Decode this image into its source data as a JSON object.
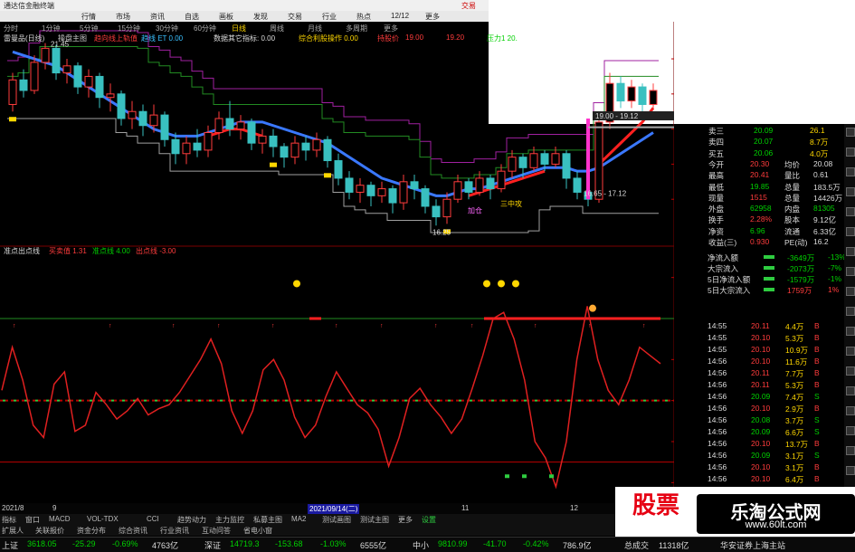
{
  "app": {
    "title": "通达信金融终端",
    "window_right": "交易",
    "menus": [
      "行情",
      "市场",
      "资讯",
      "自选",
      "画板",
      "发现",
      "交易",
      "行业",
      "热点",
      "12/12",
      "更多"
    ],
    "periods": [
      "分时",
      "1分钟",
      "5分钟",
      "15分钟",
      "30分钟",
      "60分钟",
      "日线",
      "周线",
      "月线",
      "多周期",
      "更多"
    ]
  },
  "main_chart": {
    "title": "雷曼品(日线)",
    "sub": "操盘主图",
    "indicators": [
      {
        "label": "趋向线上轨值",
        "color": "#ff3c3c"
      },
      {
        "label": "趋线 ET 0.00",
        "color": "#39c0ff"
      },
      {
        "label": "数据其它指标: 0.00",
        "color": "#dddddd"
      },
      {
        "label": "综合利股操作 0.00",
        "color": "#ffd700"
      },
      {
        "label": "持股价",
        "color": "#ff3c3c"
      },
      {
        "label": "19.00",
        "color": "#ff3c3c"
      },
      {
        "label": "19.20",
        "color": "#ff3c3c"
      },
      {
        "label": "压力1 20.",
        "color": "#00d000"
      }
    ],
    "high_label": "21.45",
    "low_label": "16.25",
    "annotations": [
      "19.00 - 19.12",
      "16.65 - 17.12"
    ],
    "markers": [
      "三中攻",
      "加仓"
    ],
    "price_axis": [
      "21.00",
      "20.00",
      "19.00",
      "18.00",
      "17.00"
    ],
    "candles": [
      {
        "o": 19.7,
        "c": 20.4,
        "h": 20.6,
        "l": 19.5
      },
      {
        "o": 20.4,
        "c": 20.1,
        "h": 20.7,
        "l": 19.9
      },
      {
        "o": 20.1,
        "c": 20.9,
        "h": 21.1,
        "l": 20.0
      },
      {
        "o": 20.9,
        "c": 21.3,
        "h": 21.45,
        "l": 20.7
      },
      {
        "o": 21.3,
        "c": 20.6,
        "h": 21.4,
        "l": 20.4
      },
      {
        "o": 20.6,
        "c": 20.8,
        "h": 21.0,
        "l": 20.3
      },
      {
        "o": 20.8,
        "c": 20.2,
        "h": 20.9,
        "l": 20.0
      },
      {
        "o": 20.2,
        "c": 20.5,
        "h": 20.7,
        "l": 19.9
      },
      {
        "o": 20.5,
        "c": 19.9,
        "h": 20.6,
        "l": 19.6
      },
      {
        "o": 19.9,
        "c": 20.0,
        "h": 20.3,
        "l": 19.5
      },
      {
        "o": 20.0,
        "c": 19.3,
        "h": 20.1,
        "l": 19.1
      },
      {
        "o": 19.3,
        "c": 19.5,
        "h": 19.8,
        "l": 19.0
      },
      {
        "o": 19.5,
        "c": 19.1,
        "h": 19.7,
        "l": 18.8
      },
      {
        "o": 19.1,
        "c": 19.4,
        "h": 19.7,
        "l": 18.9
      },
      {
        "o": 19.4,
        "c": 18.7,
        "h": 19.5,
        "l": 18.5
      },
      {
        "o": 18.7,
        "c": 18.3,
        "h": 18.9,
        "l": 18.0
      },
      {
        "o": 18.3,
        "c": 18.6,
        "h": 18.8,
        "l": 18.0
      },
      {
        "o": 18.6,
        "c": 18.4,
        "h": 19.0,
        "l": 18.2
      },
      {
        "o": 18.4,
        "c": 18.9,
        "h": 19.1,
        "l": 18.2
      },
      {
        "o": 18.9,
        "c": 19.3,
        "h": 19.5,
        "l": 18.7
      },
      {
        "o": 19.3,
        "c": 19.0,
        "h": 19.8,
        "l": 18.8
      },
      {
        "o": 19.0,
        "c": 19.2,
        "h": 19.4,
        "l": 18.7
      },
      {
        "o": 19.2,
        "c": 18.6,
        "h": 19.3,
        "l": 18.4
      },
      {
        "o": 18.6,
        "c": 18.8,
        "h": 19.0,
        "l": 18.3
      },
      {
        "o": 18.8,
        "c": 18.5,
        "h": 19.0,
        "l": 18.2
      },
      {
        "o": 18.5,
        "c": 18.2,
        "h": 18.6,
        "l": 17.9
      },
      {
        "o": 18.2,
        "c": 18.6,
        "h": 18.8,
        "l": 18.0
      },
      {
        "o": 18.6,
        "c": 18.4,
        "h": 18.8,
        "l": 18.1
      },
      {
        "o": 18.4,
        "c": 18.7,
        "h": 18.9,
        "l": 18.2
      },
      {
        "o": 18.7,
        "c": 18.1,
        "h": 18.8,
        "l": 17.9
      },
      {
        "o": 18.1,
        "c": 17.6,
        "h": 18.3,
        "l": 17.4
      },
      {
        "o": 17.6,
        "c": 17.2,
        "h": 17.8,
        "l": 17.0
      },
      {
        "o": 17.2,
        "c": 17.4,
        "h": 17.6,
        "l": 16.9
      },
      {
        "o": 17.4,
        "c": 17.1,
        "h": 17.5,
        "l": 16.8
      },
      {
        "o": 17.1,
        "c": 17.3,
        "h": 17.5,
        "l": 16.9
      },
      {
        "o": 17.3,
        "c": 16.9,
        "h": 17.4,
        "l": 16.6
      },
      {
        "o": 16.9,
        "c": 17.5,
        "h": 17.7,
        "l": 16.7
      },
      {
        "o": 17.5,
        "c": 17.3,
        "h": 17.7,
        "l": 17.0
      },
      {
        "o": 17.3,
        "c": 16.8,
        "h": 17.4,
        "l": 16.6
      },
      {
        "o": 16.8,
        "c": 16.5,
        "h": 17.0,
        "l": 16.25
      },
      {
        "o": 16.5,
        "c": 17.0,
        "h": 17.2,
        "l": 16.3
      },
      {
        "o": 17.0,
        "c": 17.5,
        "h": 17.7,
        "l": 16.9
      },
      {
        "o": 17.5,
        "c": 17.2,
        "h": 17.6,
        "l": 17.0
      },
      {
        "o": 17.2,
        "c": 17.6,
        "h": 17.8,
        "l": 17.1
      },
      {
        "o": 17.6,
        "c": 17.3,
        "h": 17.7,
        "l": 17.0
      },
      {
        "o": 17.3,
        "c": 17.8,
        "h": 18.0,
        "l": 17.2
      },
      {
        "o": 17.8,
        "c": 18.2,
        "h": 18.4,
        "l": 17.6
      },
      {
        "o": 18.2,
        "c": 17.9,
        "h": 18.3,
        "l": 17.6
      },
      {
        "o": 17.9,
        "c": 18.3,
        "h": 18.5,
        "l": 17.8
      },
      {
        "o": 18.3,
        "c": 18.0,
        "h": 18.4,
        "l": 17.8
      },
      {
        "o": 18.0,
        "c": 18.3,
        "h": 18.5,
        "l": 17.9
      },
      {
        "o": 18.3,
        "c": 17.6,
        "h": 18.4,
        "l": 17.3
      },
      {
        "o": 17.6,
        "c": 17.2,
        "h": 17.8,
        "l": 17.0
      },
      {
        "o": 17.2,
        "c": 17.0,
        "h": 17.4,
        "l": 16.8
      },
      {
        "o": 17.0,
        "c": 19.2,
        "h": 19.4,
        "l": 16.9
      },
      {
        "o": 19.2,
        "c": 20.3,
        "h": 20.6,
        "l": 19.0
      },
      {
        "o": 20.3,
        "c": 19.8,
        "h": 20.5,
        "l": 19.6
      },
      {
        "o": 19.8,
        "c": 20.2,
        "h": 20.4,
        "l": 19.6
      },
      {
        "o": 20.2,
        "c": 19.7,
        "h": 20.3,
        "l": 19.5
      },
      {
        "o": 19.7,
        "c": 20.1,
        "h": 20.3,
        "l": 19.6
      }
    ],
    "ma_blue": [
      21.2,
      21.1,
      21.0,
      20.9,
      20.8,
      20.6,
      20.4,
      20.2,
      20.0,
      19.8,
      19.6,
      19.4,
      19.2,
      19.0,
      18.9,
      18.8,
      18.8,
      18.8,
      18.9,
      19.0,
      19.1,
      19.2,
      19.2,
      19.2,
      19.1,
      19.0,
      18.9,
      18.8,
      18.7,
      18.6,
      18.4,
      18.2,
      18.0,
      17.8,
      17.6,
      17.5,
      17.4,
      17.3,
      17.2,
      17.1,
      17.1,
      17.2,
      17.3,
      17.3,
      17.4,
      17.5,
      17.6,
      17.7,
      17.8,
      17.9,
      17.9,
      17.9,
      17.8,
      17.8,
      17.9,
      18.1,
      18.3,
      18.5,
      18.7,
      18.9
    ],
    "ma_red": [
      null,
      null,
      null,
      null,
      null,
      null,
      null,
      null,
      null,
      null,
      null,
      null,
      null,
      null,
      null,
      null,
      null,
      null,
      18.8,
      18.9,
      19.0,
      19.0,
      18.9,
      18.8,
      null,
      null,
      null,
      null,
      null,
      null,
      null,
      null,
      null,
      null,
      null,
      null,
      null,
      null,
      null,
      null,
      null,
      null,
      17.1,
      17.2,
      17.3,
      17.4,
      17.5,
      17.6,
      17.7,
      17.8,
      null,
      null,
      null,
      null,
      18.0,
      18.3,
      18.6,
      18.9,
      19.2,
      19.6
    ]
  },
  "sub_chart": {
    "title": "准点出点线",
    "labels": [
      {
        "text": "买卖值 1.31",
        "color": "#ff3c3c"
      },
      {
        "text": "准点线 4.00",
        "color": "#00d000"
      },
      {
        "text": "出点线 -3.00",
        "color": "#ff3c3c"
      }
    ],
    "axis": [
      "6.00",
      "4.00",
      "2.00",
      "0.00",
      "-2.00",
      "-4.00"
    ],
    "current_tag": "2.70",
    "line": [
      0.5,
      2.6,
      1.0,
      -1.2,
      -1.8,
      0.8,
      1.4,
      -1.5,
      -1.2,
      0.4,
      -0.2,
      -0.9,
      -0.5,
      0.1,
      -0.7,
      -0.4,
      -0.2,
      0.4,
      1.2,
      2.0,
      3.0,
      1.8,
      -0.5,
      -1.6,
      -0.5,
      1.5,
      2.0,
      1.0,
      -0.8,
      -1.8,
      -1.2,
      0.2,
      1.4,
      0.6,
      -0.2,
      -0.6,
      -1.4,
      -3.2,
      -1.8,
      0.1,
      0.6,
      -0.2,
      -0.8,
      -1.6,
      -0.9,
      0.6,
      2.2,
      4.0,
      4.3,
      3.0,
      1.0,
      -2.0,
      -2.8,
      -4.2,
      -2.0,
      2.0,
      4.6,
      2.0,
      0.5,
      -0.2,
      1.0,
      2.6,
      2.2,
      1.8
    ]
  },
  "quote": {
    "rows": [
      {
        "k": "卖三",
        "v": "20.09",
        "v2": "26.1",
        "c": "green"
      },
      {
        "k": "卖四",
        "v": "20.07",
        "v2": "8.7万",
        "c": "green"
      },
      {
        "k": "买五",
        "v": "20.06",
        "v2": "4.0万",
        "c": "green"
      },
      {
        "k": "今开",
        "v": "20.30",
        "k2": "均价",
        "v3": "20.08"
      },
      {
        "k": "最高",
        "v": "20.41",
        "k2": "量比",
        "v3": "0.61"
      },
      {
        "k": "最低",
        "v": "19.85",
        "k2": "总量",
        "v3": "183.5万"
      },
      {
        "k": "现量",
        "v": "1515",
        "k2": "总量",
        "v3": "14426万"
      },
      {
        "k": "外盘",
        "v": "62958",
        "k2": "内盘",
        "v3": "81305"
      },
      {
        "k": "换手",
        "v": "2.28%",
        "k2": "股本",
        "v3": "9.12亿"
      },
      {
        "k": "净资",
        "v": "6.96",
        "k2": "流通",
        "v3": "6.33亿"
      },
      {
        "k": "收益(三)",
        "v": "0.930",
        "k2": "PE(动)",
        "v3": "16.2"
      }
    ]
  },
  "flow": [
    {
      "k": "净流入额",
      "v": "-3649万",
      "p": "-13%"
    },
    {
      "k": "大宗流入",
      "v": "-2073万",
      "p": "-7%"
    },
    {
      "k": "5日净流入额",
      "v": "-1579万",
      "p": "-1%"
    },
    {
      "k": "5日大宗流入",
      "v": "1759万",
      "p": "1%"
    }
  ],
  "ticks": [
    {
      "t": "14:55",
      "p": "20.11",
      "v": "4.4万",
      "s": "B"
    },
    {
      "t": "14:55",
      "p": "20.10",
      "v": "5.3万",
      "s": "B"
    },
    {
      "t": "14:55",
      "p": "20.10",
      "v": "10.9万",
      "s": "B"
    },
    {
      "t": "14:56",
      "p": "20.10",
      "v": "11.6万",
      "s": "B"
    },
    {
      "t": "14:56",
      "p": "20.11",
      "v": "7.7万",
      "s": "B"
    },
    {
      "t": "14:56",
      "p": "20.11",
      "v": "5.3万",
      "s": "B"
    },
    {
      "t": "14:56",
      "p": "20.09",
      "v": "7.4万",
      "s": "S"
    },
    {
      "t": "14:56",
      "p": "20.10",
      "v": "2.9万",
      "s": "B"
    },
    {
      "t": "14:56",
      "p": "20.08",
      "v": "3.7万",
      "s": "S"
    },
    {
      "t": "14:56",
      "p": "20.09",
      "v": "6.6万",
      "s": "S"
    },
    {
      "t": "14:56",
      "p": "20.10",
      "v": "13.7万",
      "s": "B"
    },
    {
      "t": "14:56",
      "p": "20.09",
      "v": "3.1万",
      "s": "S"
    },
    {
      "t": "14:56",
      "p": "20.10",
      "v": "3.1万",
      "s": "B"
    },
    {
      "t": "14:56",
      "p": "20.10",
      "v": "6.4万",
      "s": "B"
    },
    {
      "t": "14:56",
      "p": "20.11",
      "v": "43.1万",
      "s": "S"
    },
    {
      "t": "14:56",
      "p": "20.11",
      "v": "5.3万",
      "s": "B"
    }
  ],
  "datebar": [
    "2021/8",
    "9",
    "2021/09/14(二)",
    "11",
    "12"
  ],
  "tabs": [
    "指标",
    "窗口",
    "MACD",
    "VOL-TDX",
    "CCI",
    "趋势动力",
    "主力监控",
    "私募主图",
    "MA2",
    "测试画图",
    "测试主图",
    "更多",
    "设置"
  ],
  "tabs2": [
    "扩展人",
    "关联报价",
    "资金分布",
    "综合资讯",
    "行业资讯",
    "互动问答",
    "省电小窗"
  ],
  "status": [
    {
      "t": "上证",
      "c": "wht"
    },
    {
      "t": "3618.05",
      "c": "green"
    },
    {
      "t": "-25.29",
      "c": "green"
    },
    {
      "t": "-0.69%",
      "c": "green"
    },
    {
      "t": "4763亿",
      "c": "wht"
    },
    {
      "t": "深证",
      "c": "wht"
    },
    {
      "t": "14719.3",
      "c": "green"
    },
    {
      "t": "-153.68",
      "c": "green"
    },
    {
      "t": "-1.03%",
      "c": "green"
    },
    {
      "t": "6555亿",
      "c": "wht"
    },
    {
      "t": "中小",
      "c": "wht"
    },
    {
      "t": "9810.99",
      "c": "green"
    },
    {
      "t": "-41.70",
      "c": "green"
    },
    {
      "t": "-0.42%",
      "c": "green"
    },
    {
      "t": "786.9亿",
      "c": "wht"
    },
    {
      "t": "总成交",
      "c": "wht"
    },
    {
      "t": "11318亿",
      "c": "wht"
    },
    {
      "t": "华安证券上海主站",
      "c": "wht"
    }
  ],
  "banner": {
    "left": "股票",
    "main": "乐淘公式网",
    "url": "www.60lt.com"
  }
}
